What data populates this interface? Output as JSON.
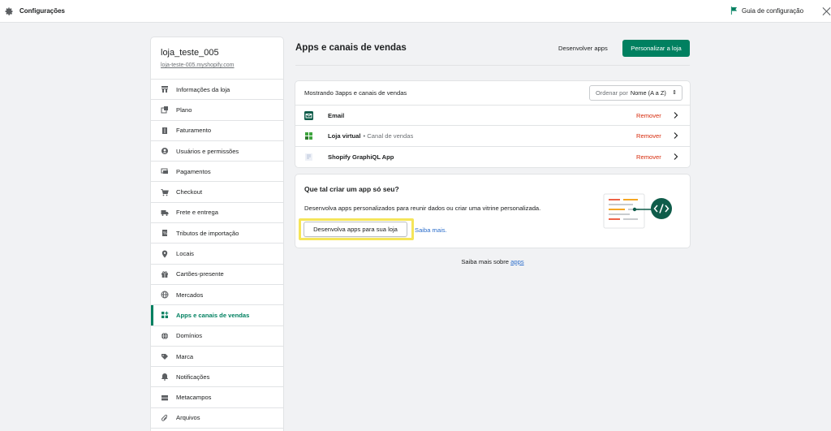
{
  "topbar": {
    "title": "Configurações",
    "guide_label": "Guia de configuração"
  },
  "store": {
    "name": "loja_teste_005",
    "url": "loja-teste-005.myshopify.com"
  },
  "sidebar": {
    "items": [
      {
        "label": "Informações da loja",
        "icon": "store-icon"
      },
      {
        "label": "Plano",
        "icon": "plan-icon"
      },
      {
        "label": "Faturamento",
        "icon": "billing-icon"
      },
      {
        "label": "Usuários e permissões",
        "icon": "user-icon"
      },
      {
        "label": "Pagamentos",
        "icon": "payments-icon"
      },
      {
        "label": "Checkout",
        "icon": "cart-icon"
      },
      {
        "label": "Frete e entrega",
        "icon": "truck-icon"
      },
      {
        "label": "Tributos de importação",
        "icon": "duties-icon"
      },
      {
        "label": "Locais",
        "icon": "location-icon"
      },
      {
        "label": "Cartões-presente",
        "icon": "gift-icon"
      },
      {
        "label": "Mercados",
        "icon": "globe-icon"
      },
      {
        "label": "Apps e canais de vendas",
        "icon": "apps-icon",
        "active": true
      },
      {
        "label": "Domínios",
        "icon": "domains-icon"
      },
      {
        "label": "Marca",
        "icon": "brand-icon"
      },
      {
        "label": "Notificações",
        "icon": "bell-icon"
      },
      {
        "label": "Metacampos",
        "icon": "metafields-icon"
      },
      {
        "label": "Arquivos",
        "icon": "paperclip-icon"
      }
    ]
  },
  "main": {
    "title": "Apps e canais de vendas",
    "dev_apps_label": "Desenvolver apps",
    "customize_label": "Personalizar a loja"
  },
  "apps_card": {
    "showing_text": "Mostrando 3apps e canais de vendas",
    "sort_prefix": "Ordenar por",
    "sort_value": "Nome (A a Z)",
    "rows": [
      {
        "name": "Email",
        "sub": "",
        "remove": "Remover",
        "icon_color": "#0f5c4a"
      },
      {
        "name": "Loja virtual",
        "sub": "• Canal de vendas",
        "remove": "Remover",
        "icon_color": "#3fa53f"
      },
      {
        "name": "Shopify GraphiQL App",
        "sub": "",
        "remove": "Remover",
        "icon_color": "#b8c3d9"
      }
    ]
  },
  "create_card": {
    "title": "Que tal criar um app só seu?",
    "description": "Desenvolva apps personalizados para reunir dados ou criar uma vitrine personalizada.",
    "button_label": "Desenvolva apps para sua loja",
    "learn_more": "Saiba mais."
  },
  "footer": {
    "prefix": "Saiba mais sobre",
    "link": "apps"
  },
  "colors": {
    "accent": "#008060",
    "danger": "#d72c0d",
    "link": "#2c6ecb",
    "highlight": "#f5e55a"
  }
}
